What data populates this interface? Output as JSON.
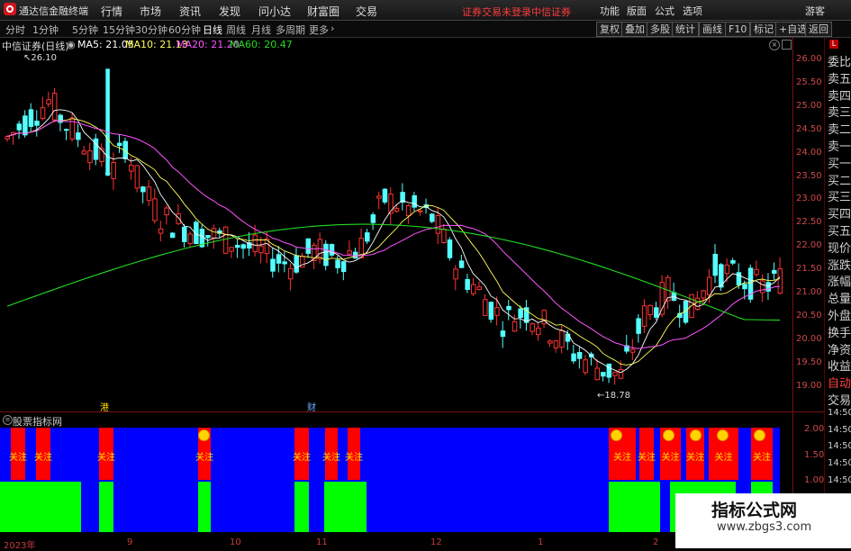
{
  "menubar": {
    "app_title": "通达信金融终端",
    "menus": [
      "行情",
      "市场",
      "资讯",
      "发现",
      "问小达",
      "财富圈",
      "交易"
    ],
    "login_status": "证券交易未登录",
    "broker": "中信证券",
    "right_menus": [
      "功能",
      "版面",
      "公式",
      "选项"
    ],
    "guest": "游客"
  },
  "toolbar": {
    "periods": [
      "分时",
      "1分钟",
      "5分钟",
      "15分钟",
      "30分钟",
      "60分钟",
      "日线",
      "周线",
      "月线",
      "多周期",
      "更多"
    ],
    "active_period": "日线",
    "tools": [
      "复权",
      "叠加",
      "多股",
      "统计",
      "画线",
      "F10",
      "标记",
      "+自选",
      "返回"
    ]
  },
  "chart_header": {
    "stock": "中信证券(日线)",
    "ma5": "MA5: 21.05",
    "ma10": "MA10: 21.13",
    "ma20": "MA20: 21.20",
    "ma60": "MA60: 20.47"
  },
  "colors": {
    "up": "#ff3232",
    "down": "#54ffff",
    "ma5": "#ffffff",
    "ma10": "#ffff55",
    "ma20": "#ff55ff",
    "ma60": "#22dd22",
    "ind_blue": "#0000ff",
    "ind_red": "#ff0000",
    "ind_green": "#00ff00"
  },
  "right_panel": {
    "labels": [
      "委比",
      "卖五",
      "卖四",
      "卖三",
      "卖二",
      "卖一",
      "买一",
      "买二",
      "买三",
      "买四",
      "买五",
      "现价",
      "涨跌",
      "涨幅",
      "总量",
      "外盘",
      "换手",
      "净资",
      "收益",
      "自动",
      "交易",
      "14:50",
      "14:50",
      "14:50",
      "14:50",
      "14:50",
      "14:50",
      "14:50",
      "14:50"
    ],
    "top_badge": "L"
  },
  "price_axis": [
    "26.00",
    "25.50",
    "25.00",
    "24.50",
    "24.00",
    "23.50",
    "23.00",
    "22.50",
    "22.00",
    "21.50",
    "21.00",
    "20.50",
    "20.00",
    "19.50",
    "19.00"
  ],
  "markers": {
    "high_label": "26.10",
    "low_label": "18.78",
    "event1": "港",
    "event2": "财"
  },
  "indicator": {
    "title": "股票指标网",
    "label": "关注",
    "ticks": [
      "2.00",
      "1.50",
      "1.00"
    ]
  },
  "date_axis": [
    "2023年",
    "9",
    "10",
    "11",
    "12",
    "1",
    "2"
  ],
  "chart_data": {
    "type": "candlestick",
    "price_range": [
      18.6,
      26.3
    ],
    "ma_labels": [
      "MA5",
      "MA10",
      "MA20",
      "MA60"
    ],
    "high": 26.1,
    "low": 18.78,
    "indicator_range": [
      0.8,
      2.1
    ]
  },
  "watermark": {
    "title": "指标公式网",
    "url": "www.zbgs3.com"
  }
}
